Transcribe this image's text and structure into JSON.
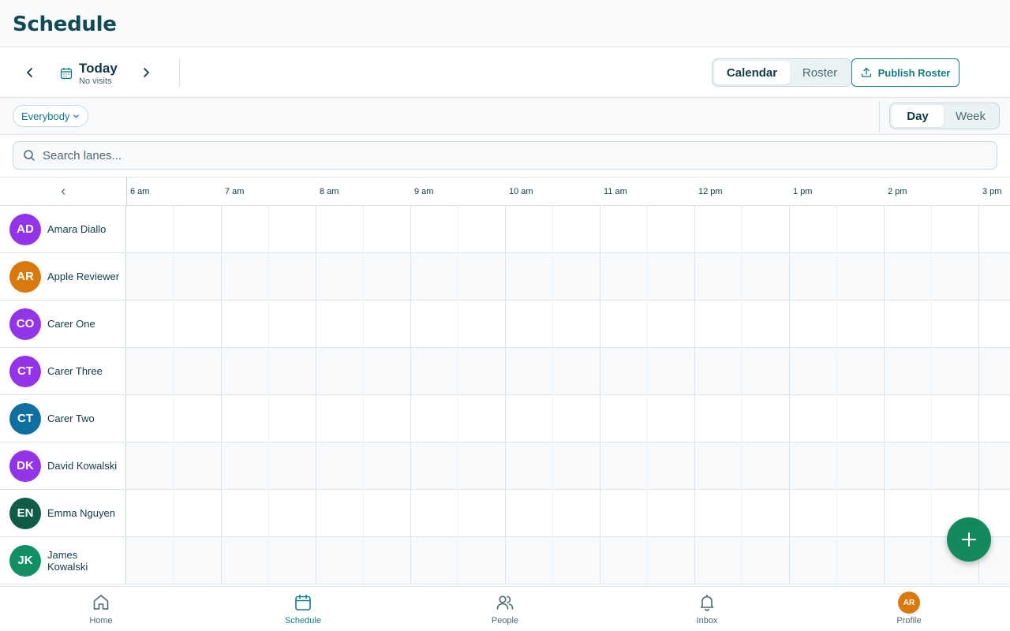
{
  "header": {
    "title": "Schedule"
  },
  "toolbar": {
    "date_label": "Today",
    "date_sub": "No visits",
    "view_tabs": [
      {
        "label": "Calendar",
        "active": true
      },
      {
        "label": "Roster",
        "active": false
      }
    ],
    "publish_label": "Publish Roster"
  },
  "filters": {
    "people_filter": "Everybody",
    "range_tabs": [
      {
        "label": "Day",
        "active": true
      },
      {
        "label": "Week",
        "active": false
      }
    ]
  },
  "search": {
    "placeholder": "Search lanes...",
    "value": ""
  },
  "timeline": {
    "hours": [
      "6 am",
      "7 am",
      "8 am",
      "9 am",
      "10 am",
      "11 am",
      "12 pm",
      "1 pm",
      "2 pm",
      "3 pm"
    ]
  },
  "lanes": [
    {
      "initials": "AD",
      "name": "Amara Diallo",
      "color": "#9333ea"
    },
    {
      "initials": "AR",
      "name": "Apple Reviewer",
      "color": "#d9790c"
    },
    {
      "initials": "CO",
      "name": "Carer One",
      "color": "#9333ea"
    },
    {
      "initials": "CT",
      "name": "Carer Three",
      "color": "#9333ea"
    },
    {
      "initials": "CT",
      "name": "Carer Two",
      "color": "#0f6fa0"
    },
    {
      "initials": "DK",
      "name": "David Kowalski",
      "color": "#9333ea"
    },
    {
      "initials": "EN",
      "name": "Emma Nguyen",
      "color": "#0f5c48"
    },
    {
      "initials": "JK",
      "name": "James Kowalski",
      "color": "#119163"
    }
  ],
  "bottom_nav": {
    "items": [
      {
        "label": "Home",
        "icon": "home-icon",
        "active": false
      },
      {
        "label": "Schedule",
        "icon": "calendar-icon",
        "active": true
      },
      {
        "label": "People",
        "icon": "people-icon",
        "active": false
      },
      {
        "label": "Inbox",
        "icon": "bell-icon",
        "active": false
      },
      {
        "label": "Profile",
        "icon": "profile-avatar",
        "active": false
      }
    ],
    "profile_initials": "AR"
  },
  "colors": {
    "accent": "#137a84",
    "fab": "#138a5c",
    "title": "#0f4a55",
    "profile": "#d9790c"
  }
}
